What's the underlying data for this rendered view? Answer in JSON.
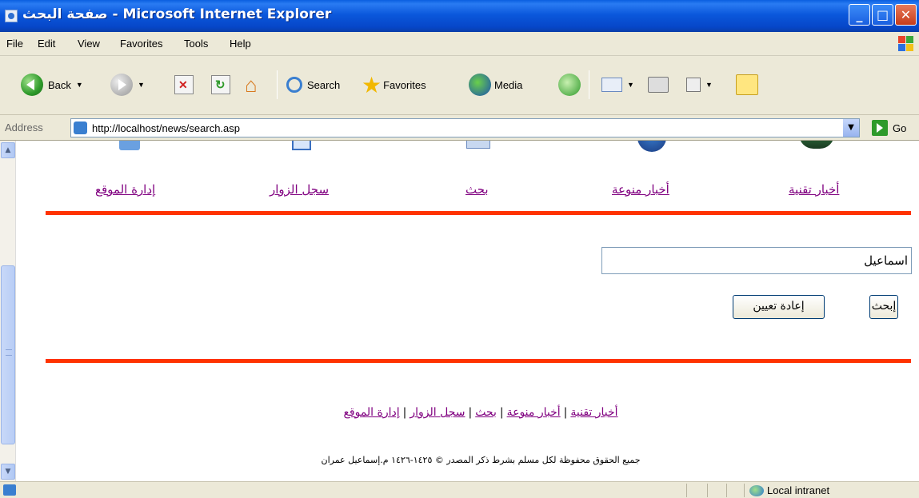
{
  "window": {
    "title": "صفحة البحث - Microsoft Internet Explorer",
    "minimize": "_",
    "maximize": "□",
    "close": "✕"
  },
  "menu": [
    "File",
    "Edit",
    "View",
    "Favorites",
    "Tools",
    "Help"
  ],
  "toolbar": {
    "back": "Back",
    "search": "Search",
    "favorites": "Favorites",
    "media": "Media"
  },
  "address": {
    "label": "Address",
    "url": "http://localhost/news/search.asp",
    "go": "Go"
  },
  "nav": {
    "items": [
      "أخبار تقنية",
      "أخبار منوعة",
      "بحث",
      "سجل الزوار",
      "إدارة الموقع"
    ]
  },
  "form": {
    "search_value": "اسماعيل",
    "submit_label": "إبحث",
    "reset_label": "إعادة تعيين"
  },
  "footer": {
    "links": [
      "أخبار تقنية",
      "أخبار منوعة",
      "بحث",
      "سجل الزوار",
      "إدارة الموقع"
    ],
    "separator": "|",
    "copyright": "جميع الحقوق محفوظة لكل مسلم بشرط ذكر المصدر © ١٤٢٥-١٤٢٦ م.إسماعيل عمران"
  },
  "status": {
    "zone": "Local intranet"
  },
  "colors": {
    "titlebar": "#0a58dc",
    "chrome": "#ece9d8",
    "visited_link": "#800080",
    "divider": "#ff3300"
  }
}
